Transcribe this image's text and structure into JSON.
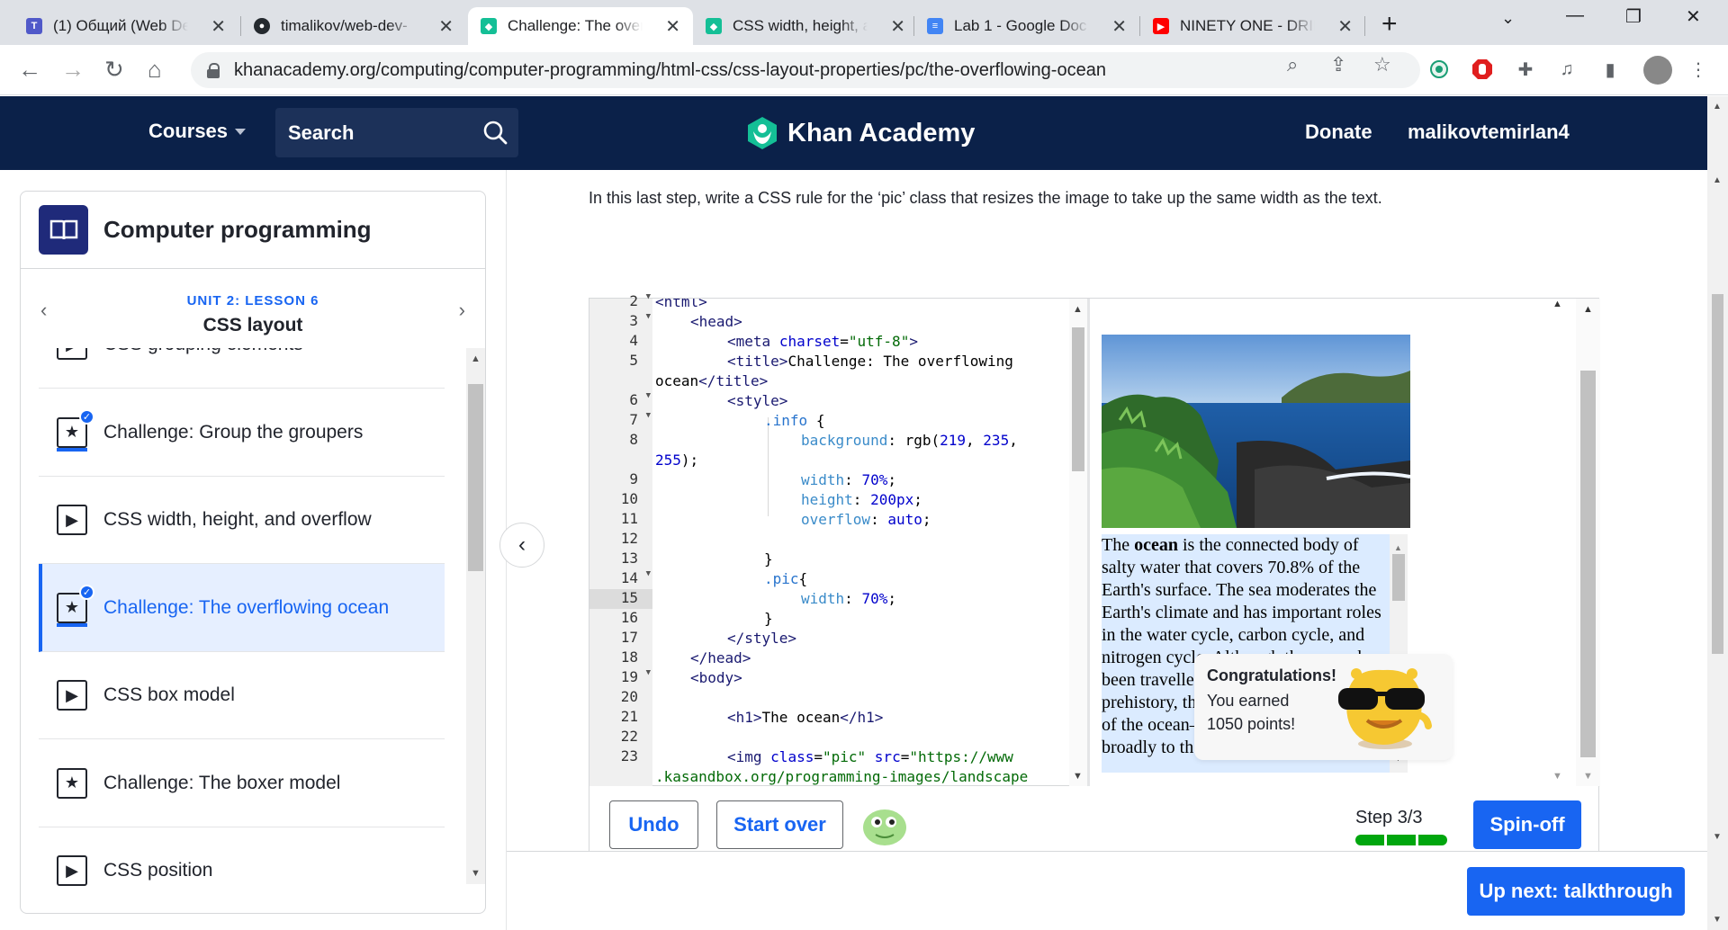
{
  "browser": {
    "tabs": [
      {
        "title": "(1) Общий (Web De",
        "icon": "teams-icon",
        "color": "#5059c9"
      },
      {
        "title": "timalikov/web-dev-",
        "icon": "github-icon",
        "color": "#24292e"
      },
      {
        "title": "Challenge: The over",
        "icon": "khan-academy-icon",
        "color": "#14bf96"
      },
      {
        "title": "CSS width, height, a",
        "icon": "khan-academy-icon",
        "color": "#14bf96"
      },
      {
        "title": "Lab 1 - Google Doc",
        "icon": "google-docs-icon",
        "color": "#4285f4"
      },
      {
        "title": "NINETY ONE - DRIF",
        "icon": "youtube-icon",
        "color": "#ff0000"
      }
    ],
    "url": "khanacademy.org/computing/computer-programming/html-css/css-layout-properties/pc/the-overflowing-ocean"
  },
  "header": {
    "courses_label": "Courses",
    "search_placeholder": "Search",
    "logo_text": "Khan Academy",
    "donate_label": "Donate",
    "username": "malikovtemirlan4",
    "bg_color": "#0b2149"
  },
  "sidebar": {
    "course_title": "Computer programming",
    "unit_label": "UNIT 2: LESSON 6",
    "lesson_title": "CSS layout",
    "items": [
      {
        "label": "CSS grouping elements",
        "type": "video"
      },
      {
        "label": "Challenge: Group the groupers",
        "type": "challenge",
        "completed": true
      },
      {
        "label": "CSS width, height, and overflow",
        "type": "video"
      },
      {
        "label": "Challenge: The overflowing ocean",
        "type": "challenge",
        "completed": true,
        "current": true
      },
      {
        "label": "CSS box model",
        "type": "video"
      },
      {
        "label": "Challenge: The boxer model",
        "type": "challenge"
      },
      {
        "label": "CSS position",
        "type": "video"
      }
    ]
  },
  "main": {
    "instructions": "In this last step, write a CSS rule for the ‘pic’ class that resizes the image to take up the same width as the text.",
    "line_numbers": [
      "2",
      "3",
      "4",
      "5",
      "",
      "6",
      "7",
      "8",
      "",
      "9",
      "10",
      "11",
      "12",
      "13",
      "14",
      "15",
      "16",
      "17",
      "18",
      "19",
      "20",
      "21",
      "22",
      "23"
    ],
    "preview_text_html": "The <b>ocean</b> is the connected body of salty water that covers 70.8% of the Earth's surface. The sea moderates the Earth's climate and has important roles in the water cycle, carbon cycle, and nitrogen cycle. Although the ocean has been travelled and explored since prehistory, the modern scientific study of the ocean—oceanography—dates broadly to the",
    "congrats": {
      "title": "Congratulations!",
      "line1": "You earned",
      "line2": "1050 points!"
    },
    "undo_label": "Undo",
    "start_over_label": "Start over",
    "step_label": "Step 3/3",
    "spinoff_label": "Spin-off",
    "up_next_label": "Up next: talkthrough"
  }
}
